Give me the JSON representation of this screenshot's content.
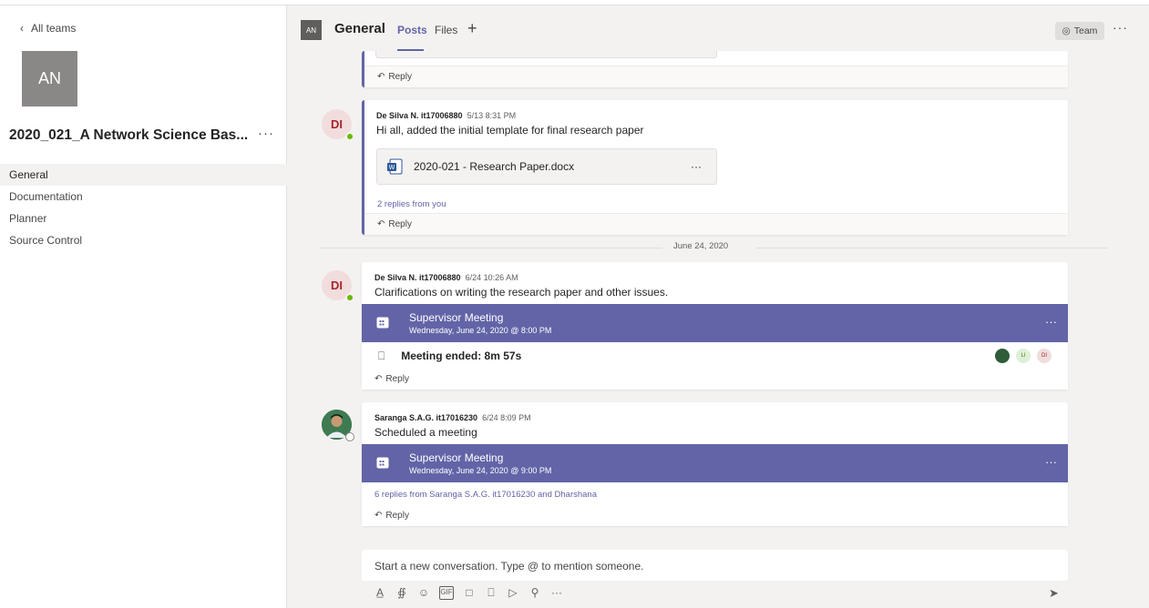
{
  "sidebar": {
    "back_label": "All teams",
    "team_initials": "AN",
    "team_name": "2020_021_A Network Science Bas...",
    "more": "···",
    "channels": [
      "General",
      "Documentation",
      "Planner",
      "Source Control"
    ],
    "active_channel": "General"
  },
  "header": {
    "initials": "AN",
    "channel": "General",
    "tabs": [
      "Posts",
      "Files"
    ],
    "add": "+",
    "team_button": "Team",
    "more": "···"
  },
  "posts": [
    {
      "reply": "Reply"
    },
    {
      "author": "De Silva N. it17006880",
      "time": "5/13 8:31 PM",
      "avatar": "DI",
      "text": "Hi all, added the initial template for final research paper",
      "file": "2020-021 - Research Paper.docx",
      "replies": "2 replies from you",
      "reply": "Reply"
    },
    {
      "author": "De Silva N. it17006880",
      "time": "6/24 10:26 AM",
      "avatar": "DI",
      "text": "Clarifications on writing the research paper and other issues.",
      "meeting_title": "Supervisor Meeting",
      "meeting_date": "Wednesday, June 24, 2020 @ 8:00 PM",
      "meeting_ended": "Meeting ended: 8m 57s",
      "participants": [
        "LI",
        "DI"
      ],
      "reply": "Reply"
    },
    {
      "author": "Saranga S.A.G. it17016230",
      "time": "6/24 8:09 PM",
      "text": "Scheduled a meeting",
      "meeting_title": "Supervisor Meeting",
      "meeting_date": "Wednesday, June 24, 2020 @ 9:00 PM",
      "replies": "6 replies from Saranga S.A.G. it17016230 and Dharshana",
      "reply": "Reply"
    }
  ],
  "date_separator": "June 24, 2020",
  "compose": {
    "placeholder": "Start a new conversation. Type @ to mention someone.",
    "toolbar_icons": [
      "format-icon",
      "attach-icon",
      "emoji-icon",
      "gif-icon",
      "sticker-icon",
      "meet-now-icon",
      "stream-icon",
      "praise-icon",
      "more-icon"
    ]
  },
  "colors": {
    "accent": "#6264a7",
    "presence_available": "#6bb700",
    "background": "#f3f2f1"
  }
}
